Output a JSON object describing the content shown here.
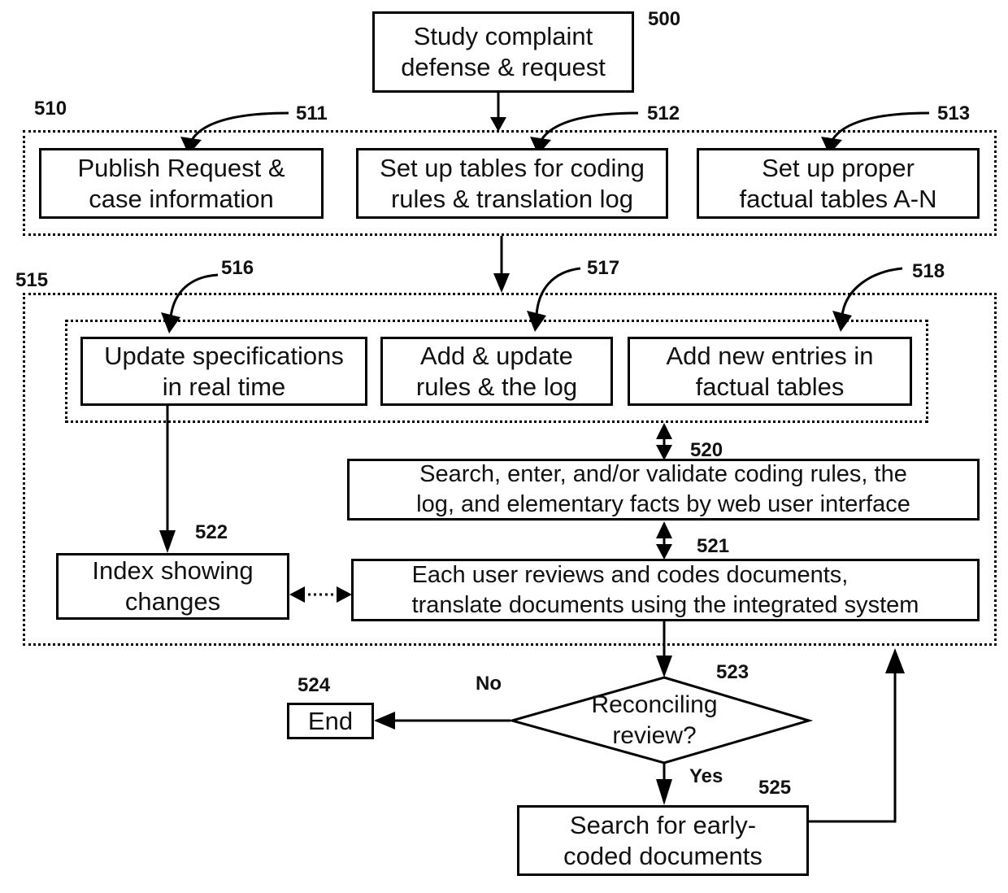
{
  "figure": {
    "refs": {
      "r500": "500",
      "r510": "510",
      "r511": "511",
      "r512": "512",
      "r513": "513",
      "r515": "515",
      "r516": "516",
      "r517": "517",
      "r518": "518",
      "r520": "520",
      "r521": "521",
      "r522": "522",
      "r523": "523",
      "r524": "524",
      "r525": "525"
    },
    "nodes": {
      "study": [
        "Study complaint",
        "defense & request"
      ],
      "publish": [
        "Publish Request &",
        "case information"
      ],
      "setup_tables": [
        "Set up tables for coding",
        "rules & translation log"
      ],
      "setup_factual": [
        "Set up proper",
        "factual tables A-N"
      ],
      "update_specs": [
        "Update specifications",
        "in real time"
      ],
      "add_rules": [
        "Add & update",
        "rules & the log"
      ],
      "add_entries": [
        "Add new entries in",
        "factual tables"
      ],
      "search_validate": [
        "Search, enter, and/or validate coding rules, the",
        "log, and elementary facts by web user interface"
      ],
      "index": [
        "Index showing",
        "changes"
      ],
      "each_user": [
        "Each user reviews and codes documents,",
        "translate documents using the integrated system"
      ],
      "decision": [
        "Reconciling",
        "review?"
      ],
      "end": [
        "End"
      ],
      "search_early": [
        "Search for early-",
        "coded documents"
      ]
    },
    "edge_labels": {
      "no": "No",
      "yes": "Yes"
    }
  }
}
